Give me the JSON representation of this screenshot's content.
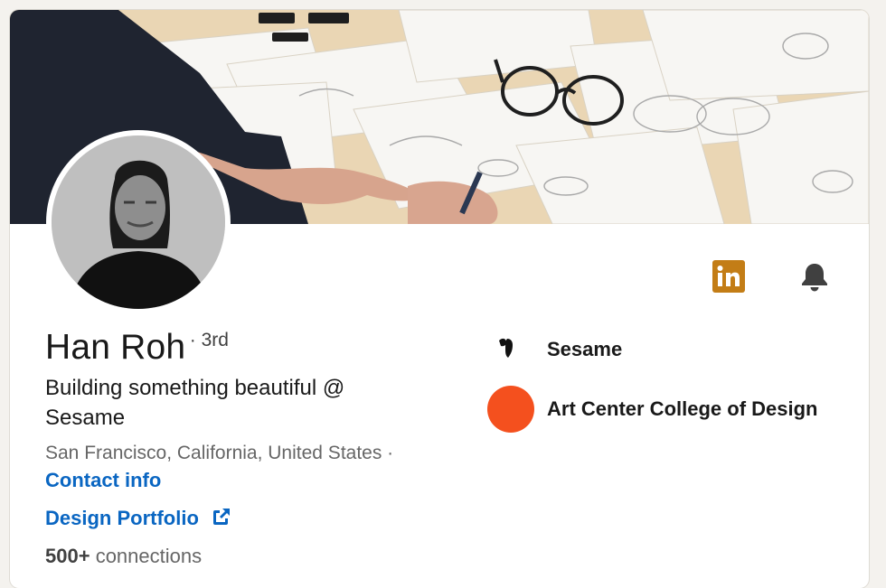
{
  "profile": {
    "name": "Han Roh",
    "degree": "· 3rd",
    "headline": "Building something beautiful @ Sesame",
    "location": "San Francisco, California, United States ·",
    "contact_link": "Contact info",
    "website_link": "Design Portfolio",
    "connections_count": "500+",
    "connections_label": "connections"
  },
  "orgs": [
    {
      "name": "Sesame",
      "logo": "sesame-logo"
    },
    {
      "name": "Art Center College of Design",
      "logo": "art-center-logo"
    }
  ],
  "icons": {
    "linkedin": "linkedin-icon",
    "bell": "bell-icon",
    "external_link": "external-link-icon"
  },
  "colors": {
    "link": "#0a66c2",
    "linkedin_badge": "#c37d16",
    "art_center": "#f4501e",
    "page_bg": "#f4f2ee"
  }
}
